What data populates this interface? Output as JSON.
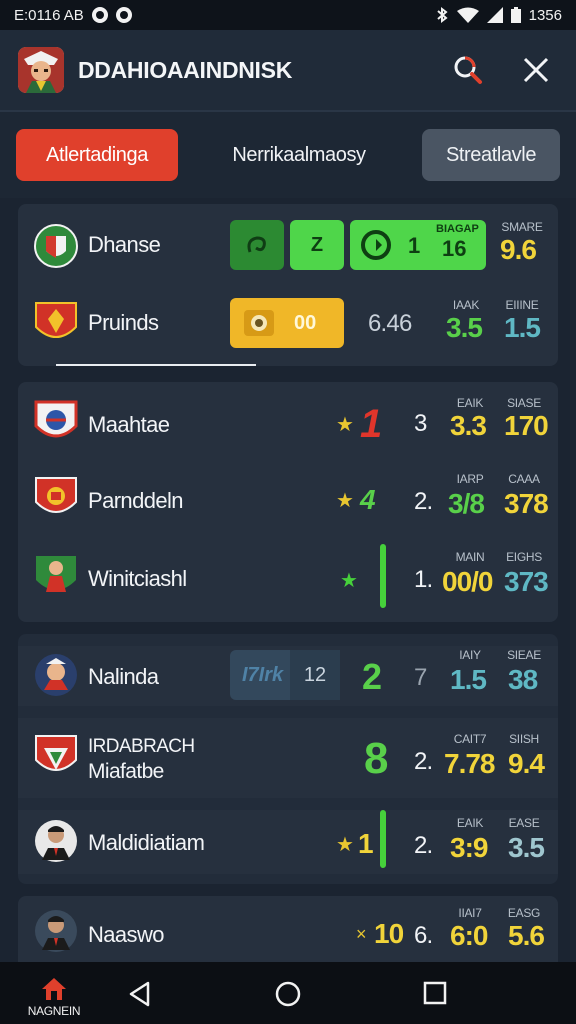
{
  "status_bar": {
    "time": "E:0116 AB",
    "battery_text": "1356"
  },
  "header": {
    "title": "DDAHIOAAINDNISK"
  },
  "tabs": [
    {
      "label": "Atlertadinga",
      "active": true
    },
    {
      "label": "Nerrikaalmaosy",
      "active": false
    },
    {
      "label": "Streatlavle",
      "active": false
    }
  ],
  "card1": {
    "row1": {
      "team": "Dhanse",
      "pill_a": "",
      "pill_b": "Z",
      "pill_c_num": "1",
      "pill_c_label": "BIAGAP",
      "pill_c_value": "16",
      "col_label": "SMARE",
      "col_value": "9.6"
    },
    "row2": {
      "team": "Pruinds",
      "pill_value": "00",
      "value1": "6.46",
      "label2": "IAAK",
      "value2": "3.5",
      "label3": "EIIINE",
      "value3": "1.5"
    }
  },
  "card2": {
    "rows": [
      {
        "team": "Maahtae",
        "rank": "1",
        "num": "3",
        "label1": "EAIK",
        "value1": "3.3",
        "label2": "SIASE",
        "value2": "170"
      },
      {
        "team": "Parnddeln",
        "rank": "4",
        "num": "2.",
        "label1": "IARP",
        "value1": "3/8",
        "label2": "CAAA",
        "value2": "378"
      },
      {
        "team": "Winitciashl",
        "rank": "",
        "num": "1.",
        "label1": "MAIN",
        "value1": "00/0",
        "label2": "EIGHS",
        "value2": "373"
      }
    ]
  },
  "card3": {
    "rows": [
      {
        "team": "Nalinda",
        "pill_a": "I7Irk",
        "pill_b": "12",
        "rank": "2",
        "num": "7",
        "label1": "IAIY",
        "value1": "1.5",
        "label2": "SIEAE",
        "value2": "38"
      },
      {
        "team_line1": "IRDABRACH",
        "team_line2": "Miafatbe",
        "rank": "8",
        "num": "2.",
        "label1": "CAIT7",
        "value1": "7.78",
        "label2": "SIISH",
        "value2": "9.4"
      },
      {
        "team": "Maldidiatiam",
        "rank": "1",
        "num": "2.",
        "label1": "EAIK",
        "value1": "3:9",
        "label2": "EASE",
        "value2": "3.5"
      }
    ]
  },
  "card4": {
    "row": {
      "team": "Naaswo",
      "rank": "10",
      "num": "6.",
      "label1": "IIAI7",
      "value1": "6:0",
      "label2": "EASG",
      "value2": "5.6"
    }
  },
  "bottom_nav": {
    "home_label": "NAGNEIN"
  },
  "colors": {
    "accent": "#e0402c",
    "green": "#46d13b",
    "yellow": "#f1d43a",
    "teal": "#5fb8c4"
  }
}
